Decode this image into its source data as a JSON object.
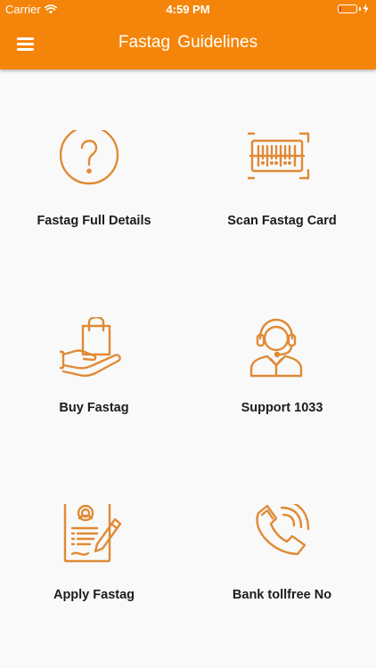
{
  "status_bar": {
    "carrier": "Carrier",
    "time": "4:59 PM",
    "battery_level": 0.12
  },
  "nav": {
    "title": "Fastag Guidelines"
  },
  "colors": {
    "primary": "#f5850a",
    "icon": "#e08a35",
    "background": "#f9f9f9"
  },
  "tiles": [
    {
      "label": "Fastag Full Details",
      "icon": "question-circle-icon"
    },
    {
      "label": "Scan Fastag Card",
      "icon": "barcode-scan-icon"
    },
    {
      "label": "Buy Fastag",
      "icon": "shopping-bag-hand-icon"
    },
    {
      "label": "Support 1033",
      "icon": "support-headset-icon"
    },
    {
      "label": "Apply Fastag",
      "icon": "application-form-icon"
    },
    {
      "label": "Bank tollfree No",
      "icon": "phone-call-icon"
    }
  ]
}
